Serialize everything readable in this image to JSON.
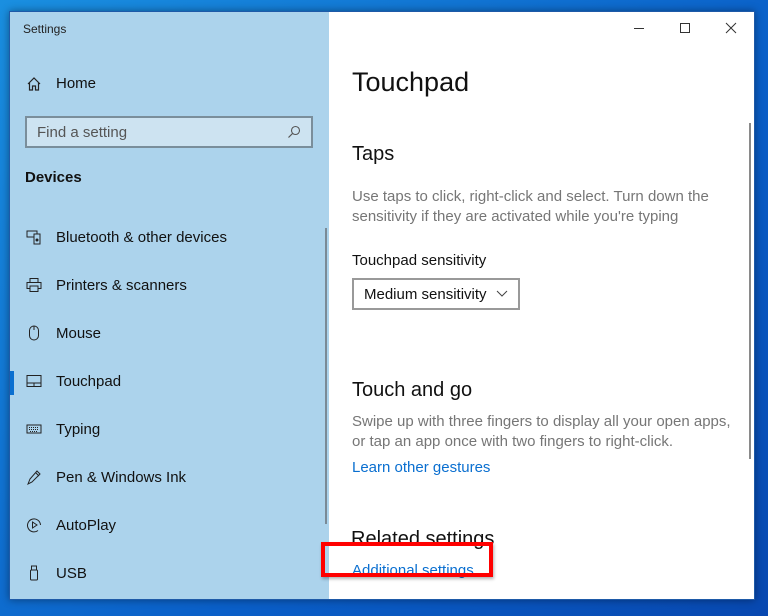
{
  "window": {
    "title": "Settings"
  },
  "sidebar": {
    "home_label": "Home",
    "search_placeholder": "Find a setting",
    "section": "Devices",
    "items": [
      {
        "label": "Bluetooth & other devices",
        "icon": "bluetooth-devices-icon"
      },
      {
        "label": "Printers & scanners",
        "icon": "printer-icon"
      },
      {
        "label": "Mouse",
        "icon": "mouse-icon"
      },
      {
        "label": "Touchpad",
        "icon": "touchpad-icon",
        "selected": true
      },
      {
        "label": "Typing",
        "icon": "keyboard-icon"
      },
      {
        "label": "Pen & Windows Ink",
        "icon": "pen-icon"
      },
      {
        "label": "AutoPlay",
        "icon": "autoplay-icon"
      },
      {
        "label": "USB",
        "icon": "usb-icon"
      }
    ]
  },
  "main": {
    "title": "Touchpad",
    "taps": {
      "heading": "Taps",
      "description": "Use taps to click, right-click and select. Turn down the sensitivity if they are activated while you're typing",
      "sensitivity_label": "Touchpad sensitivity",
      "sensitivity_value": "Medium sensitivity"
    },
    "touch_and_go": {
      "heading": "Touch and go",
      "description": "Swipe up with three fingers to display all your open apps, or tap an app once with two fingers to right-click.",
      "link": "Learn other gestures"
    },
    "related": {
      "heading": "Related settings",
      "link": "Additional settings"
    }
  },
  "colors": {
    "accent": "#0a6fd0",
    "highlight": "#ff0000",
    "sidebar": "#acd3ec"
  }
}
